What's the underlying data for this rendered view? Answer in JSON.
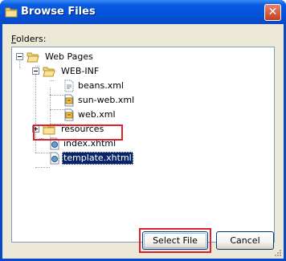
{
  "window": {
    "title": "Browse Files",
    "close_glyph": "✕"
  },
  "folders_label": {
    "mnemonic": "F",
    "rest": "olders:"
  },
  "tree": [
    {
      "label": "Web Pages",
      "icon": "folder-open-icon",
      "expanded": true
    },
    {
      "label": "WEB-INF",
      "icon": "folder-open-icon",
      "expanded": true
    },
    {
      "label": "beans.xml",
      "icon": "xml-file-icon"
    },
    {
      "label": "sun-web.xml",
      "icon": "xml-config-file-icon"
    },
    {
      "label": "web.xml",
      "icon": "xml-config-file-icon"
    },
    {
      "label": "resources",
      "icon": "folder-icon",
      "expanded": false
    },
    {
      "label": "index.xhtml",
      "icon": "xhtml-file-icon"
    },
    {
      "label": "template.xhtml",
      "icon": "xhtml-file-icon",
      "selected": true
    }
  ],
  "buttons": {
    "select": "Select File",
    "cancel": "Cancel"
  },
  "colors": {
    "titlebar": "#0052d8",
    "selection": "#0a246a",
    "highlight_box": "#e0202a",
    "dialog_bg": "#ece9d8"
  }
}
